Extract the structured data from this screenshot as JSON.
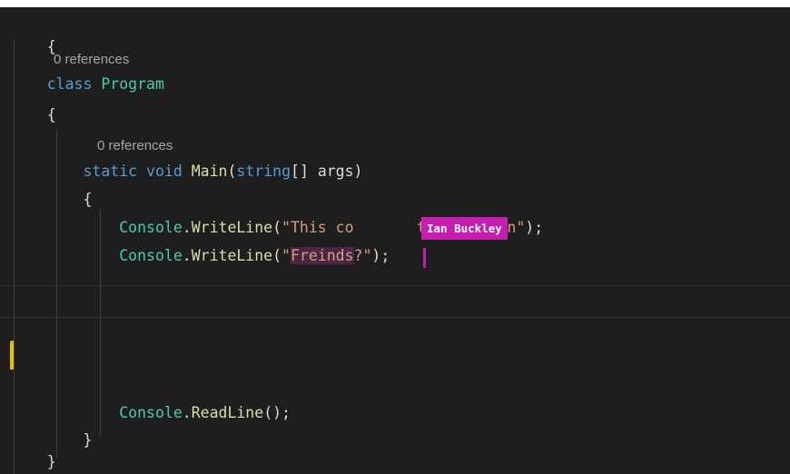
{
  "editor": {
    "code_lens": [
      "0 references",
      "0 references"
    ],
    "lines": {
      "open_brace_ns": "{",
      "class_kw": "class",
      "class_name": "Program",
      "open_brace_class": "{",
      "static_kw": "static",
      "void_kw": "void",
      "main_name": "Main",
      "main_open": "(",
      "string_kw": "string",
      "main_params": "[] args)",
      "open_brace_main": "{",
      "console": "Console",
      "dot": ".",
      "writeline": "WriteLine",
      "paren_open": "(",
      "line1_str_a": "\"This co",
      "line1_str_b": "tten by Ian\"",
      "line_end": ");",
      "line2_str_quote": "\"",
      "line2_str_word": "Freinds",
      "line2_str_rest": "?\"",
      "readline": "ReadLine",
      "readline_args": "();",
      "close_brace_main": "}",
      "close_brace_class": "}"
    },
    "collaborator": {
      "name": "Ian Buckley",
      "color": "#c41fb0"
    }
  }
}
